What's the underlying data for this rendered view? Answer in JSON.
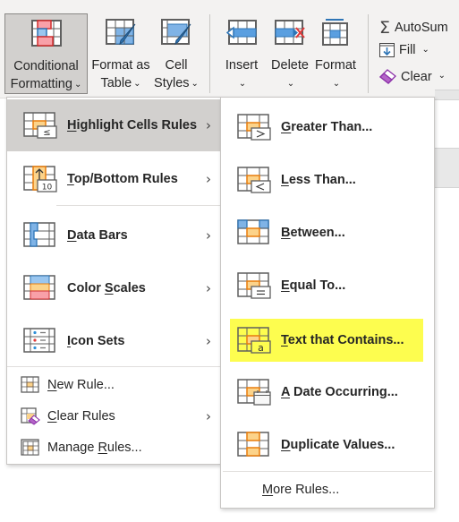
{
  "ribbon": {
    "conditional_formatting": {
      "line1": "Conditional",
      "line2": "Formatting"
    },
    "format_as_table": {
      "line1": "Format as",
      "line2": "Table"
    },
    "cell_styles": {
      "line1": "Cell",
      "line2": "Styles"
    },
    "insert": "Insert",
    "delete": "Delete",
    "format": "Format",
    "autosum": "AutoSum",
    "fill": "Fill",
    "clear": "Clear",
    "chevron": "⌄"
  },
  "main_menu": {
    "items": [
      {
        "key": "H",
        "rest": "ighlight Cells Rules",
        "icon": "highlight-cells-icon",
        "submenu": true,
        "active": true
      },
      {
        "key": "T",
        "rest": "op/Bottom Rules",
        "icon": "top-bottom-icon",
        "submenu": true
      },
      {
        "key": "D",
        "rest": "ata Bars",
        "icon": "data-bars-icon",
        "submenu": true
      },
      {
        "pre": "Color ",
        "key": "S",
        "rest": "cales",
        "icon": "color-scales-icon",
        "submenu": true
      },
      {
        "key": "I",
        "rest": "con Sets",
        "icon": "icon-sets-icon",
        "submenu": true
      }
    ],
    "small_items": [
      {
        "key": "N",
        "rest": "ew Rule...",
        "icon": "new-rule-icon"
      },
      {
        "key": "C",
        "rest": "lear Rules",
        "icon": "clear-rules-icon",
        "submenu": true
      },
      {
        "pre": "Manage ",
        "key": "R",
        "rest": "ules...",
        "icon": "manage-rules-icon"
      }
    ]
  },
  "sub_menu": {
    "items": [
      {
        "key": "G",
        "rest": "reater Than..."
      },
      {
        "key": "L",
        "rest": "ess Than..."
      },
      {
        "key": "B",
        "rest": "etween..."
      },
      {
        "key": "E",
        "rest": "qual To..."
      },
      {
        "key": "T",
        "rest": "ext that Contains...",
        "highlighted": true
      },
      {
        "key": "A",
        "rest": " Date Occurring..."
      },
      {
        "key": "D",
        "rest": "uplicate Values..."
      }
    ],
    "more": {
      "key": "M",
      "rest": "ore Rules..."
    }
  },
  "colors": {
    "highlight": "#fdfd4f",
    "hover": "#d2d0ce",
    "orange": "#e87d0d",
    "blue": "#2e75b6",
    "red": "#e03a3a"
  },
  "arrow": "›"
}
